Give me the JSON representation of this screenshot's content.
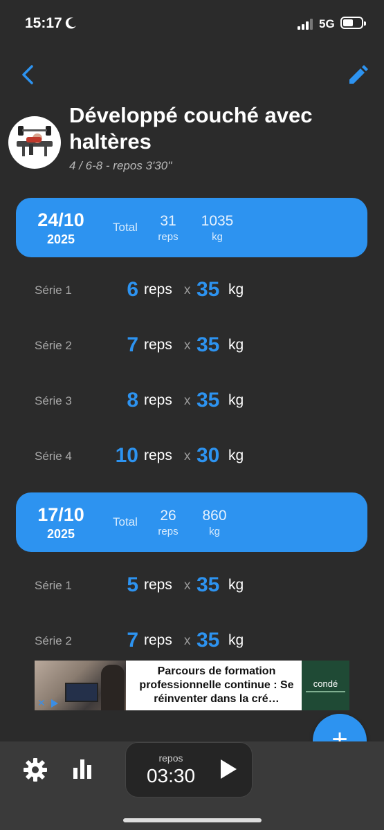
{
  "status_bar": {
    "time": "15:17",
    "network": "5G"
  },
  "header": {
    "back_icon": "chevron-left-icon",
    "edit_icon": "pencil-icon"
  },
  "exercise": {
    "title": "Développé couché avec haltères",
    "subtitle": "4 / 6-8 - repos 3'30''"
  },
  "sessions": [
    {
      "date": "24/10",
      "year": "2025",
      "total_label": "Total",
      "reps_total": "31",
      "reps_unit": "reps",
      "kg_total": "1035",
      "kg_unit": "kg",
      "sets": [
        {
          "label": "Série 1",
          "reps": "6",
          "reps_unit": "reps",
          "x": "x",
          "kg": "35",
          "kg_unit": "kg"
        },
        {
          "label": "Série 2",
          "reps": "7",
          "reps_unit": "reps",
          "x": "x",
          "kg": "35",
          "kg_unit": "kg"
        },
        {
          "label": "Série 3",
          "reps": "8",
          "reps_unit": "reps",
          "x": "x",
          "kg": "35",
          "kg_unit": "kg"
        },
        {
          "label": "Série 4",
          "reps": "10",
          "reps_unit": "reps",
          "x": "x",
          "kg": "30",
          "kg_unit": "kg"
        }
      ]
    },
    {
      "date": "17/10",
      "year": "2025",
      "total_label": "Total",
      "reps_total": "26",
      "reps_unit": "reps",
      "kg_total": "860",
      "kg_unit": "kg",
      "sets": [
        {
          "label": "Série 1",
          "reps": "5",
          "reps_unit": "reps",
          "x": "x",
          "kg": "35",
          "kg_unit": "kg"
        },
        {
          "label": "Série 2",
          "reps": "7",
          "reps_unit": "reps",
          "x": "x",
          "kg": "35",
          "kg_unit": "kg"
        }
      ]
    }
  ],
  "ad": {
    "text": "Parcours de formation professionnelle continue : Se réinventer dans la cré…",
    "brand": "condé"
  },
  "fab": {
    "label": "+"
  },
  "bottom_bar": {
    "settings_icon": "gear-icon",
    "stats_icon": "bar-chart-icon",
    "timer_label": "repos",
    "timer_value": "03:30",
    "play_icon": "play-icon"
  },
  "colors": {
    "accent": "#2d93f0",
    "background": "#2b2b2b",
    "bottom_bar": "#3a3a3a"
  }
}
